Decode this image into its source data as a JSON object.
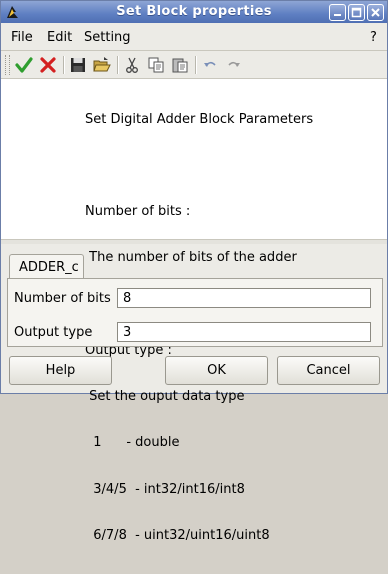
{
  "window": {
    "title": "Set Block properties",
    "titlebar_color": "#5e7fc2"
  },
  "menu": {
    "file": "File",
    "edit": "Edit",
    "setting": "Setting",
    "help": "?"
  },
  "toolbar": {
    "icons": [
      "ok-check-icon",
      "cancel-x-icon",
      "save-icon",
      "open-folder-icon",
      "cut-icon",
      "copy-icon",
      "paste-icon",
      "undo-icon",
      "redo-icon"
    ]
  },
  "description": {
    "heading": "Set Digital Adder Block Parameters",
    "bits_title": "Number of bits :",
    "bits_desc": " The number of bits of the adder",
    "type_title": "Output type :",
    "type_desc": " Set the ouput data type",
    "type_opt1": "  1      - double",
    "type_opt2": "  3/4/5  - int32/int16/int8",
    "type_opt3": "  6/7/8  - uint32/uint16/uint8"
  },
  "tab": {
    "label": "ADDER_c"
  },
  "fields": {
    "bits_label": "Number of bits",
    "bits_value": "8",
    "type_label": "Output type",
    "type_value": "3"
  },
  "buttons": {
    "help": "Help",
    "ok": "OK",
    "cancel": "Cancel"
  },
  "colors": {
    "ok_green": "#2f9e2f",
    "cancel_red": "#d42020"
  }
}
